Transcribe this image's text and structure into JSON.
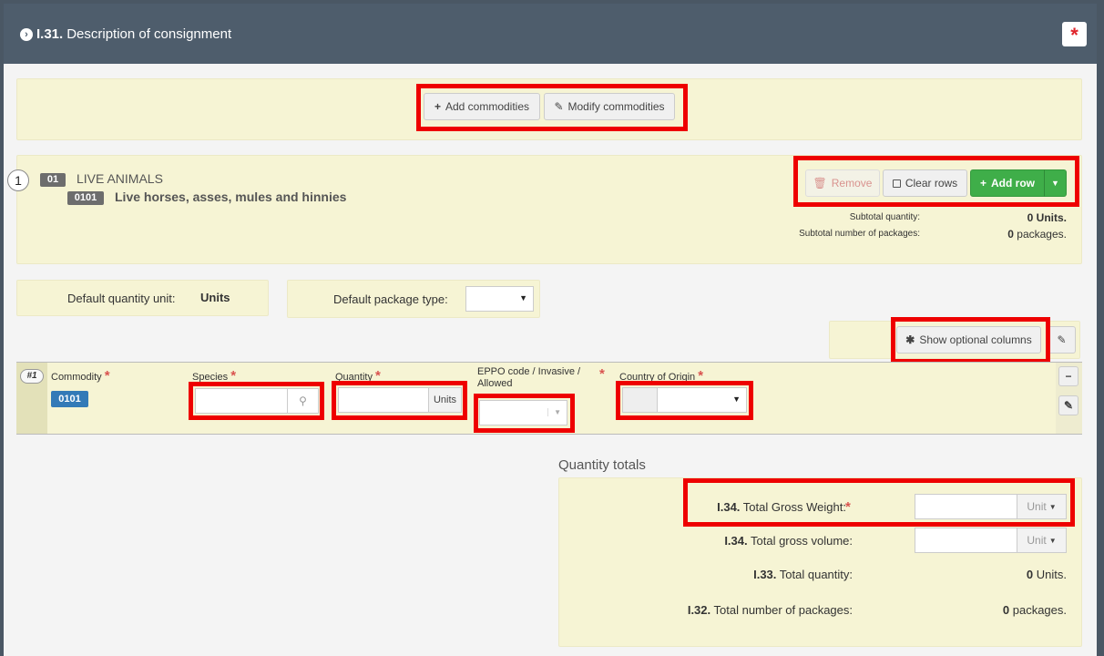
{
  "header": {
    "number": "I.31.",
    "title": "Description of consignment"
  },
  "toolbar": {
    "add_commodities": "Add commodities",
    "modify_commodities": "Modify commodities"
  },
  "commodity": {
    "index": "1",
    "chapter_code": "01",
    "chapter_name": "LIVE ANIMALS",
    "code": "0101",
    "name": "Live horses, asses, mules and hinnies",
    "remove_label": "Remove",
    "clear_rows_label": "Clear rows",
    "add_row_label": "Add row",
    "subtotal_quantity_label": "Subtotal quantity:",
    "subtotal_quantity_value": "0 Units.",
    "subtotal_packages_label": "Subtotal number of packages:",
    "subtotal_packages_value": "0 packages."
  },
  "defaults": {
    "quantity_unit_label": "Default quantity unit:",
    "quantity_unit_value": "Units",
    "package_type_label": "Default package type:"
  },
  "optional": {
    "show_label": "Show optional columns"
  },
  "row": {
    "num": "#1",
    "commodity_label": "Commodity",
    "commodity_code": "0101",
    "species_label": "Species",
    "quantity_label": "Quantity",
    "quantity_unit": "Units",
    "eppo_label_line1": "EPPO code / Invasive /",
    "eppo_label_line2": "Allowed",
    "country_label": "Country of Origin"
  },
  "totals": {
    "heading": "Quantity totals",
    "gross_weight_num": "I.34.",
    "gross_weight_label": "Total Gross Weight:",
    "gross_weight_unit": "Unit",
    "gross_volume_num": "I.34.",
    "gross_volume_label": "Total gross volume:",
    "gross_volume_unit": "Unit",
    "total_quantity_num": "I.33.",
    "total_quantity_label": "Total quantity:",
    "total_quantity_value": "0 Units.",
    "total_packages_num": "I.32.",
    "total_packages_label": "Total number of packages:",
    "total_packages_value": "0 packages."
  },
  "colors": {
    "header_bg": "#4e5d6c",
    "panel_bg": "#f6f4d4",
    "accent_red": "#ee0000",
    "add_green": "#3fae49",
    "code_blue": "#337ab7"
  }
}
